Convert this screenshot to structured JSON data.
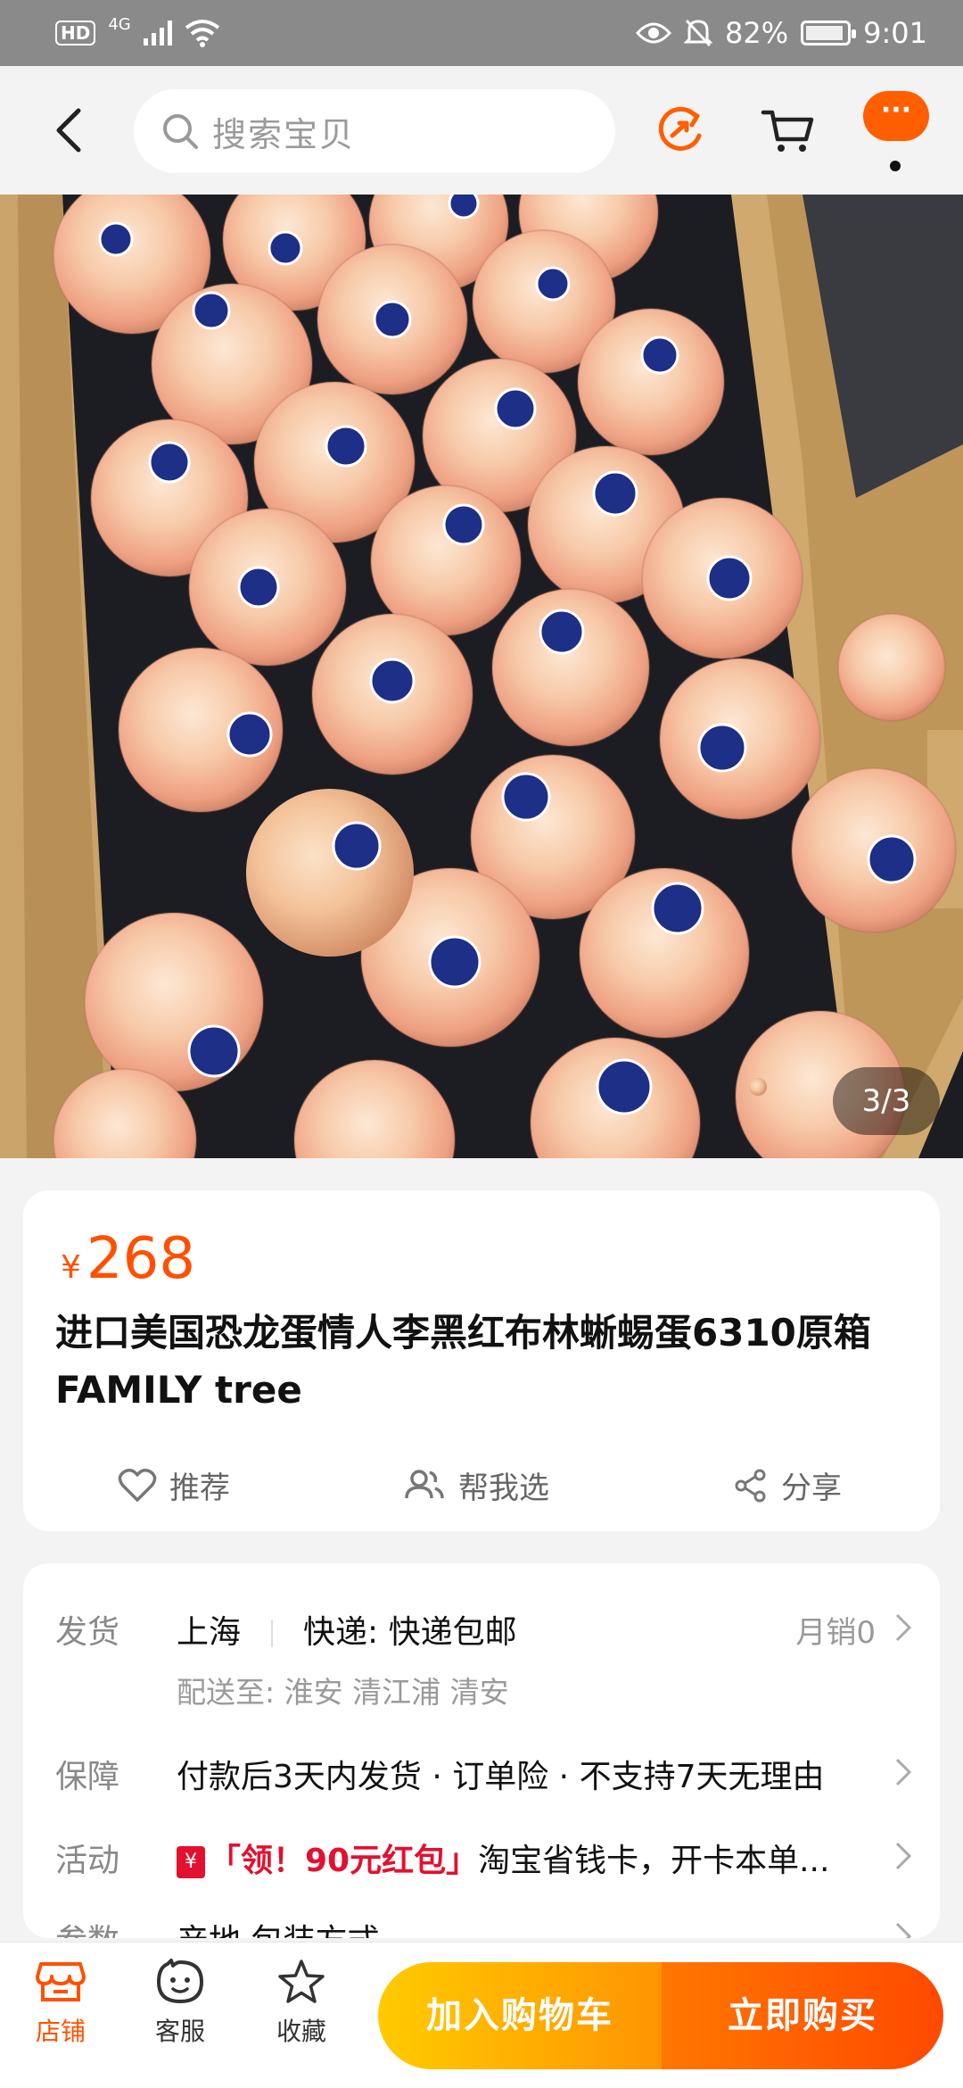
{
  "status_bar": {
    "hd": "HD",
    "network": "4G",
    "battery": "82%",
    "time": "9:01"
  },
  "top_nav": {
    "search_placeholder": "搜索宝贝",
    "more_label": "···",
    "accent_color": "#ff5f00"
  },
  "gallery": {
    "indicator": "3/3"
  },
  "product": {
    "currency": "¥",
    "price": "268",
    "title": "进口美国恐龙蛋情人李黑红布林蜥蜴蛋6310原箱 FAMILY tree",
    "actions": {
      "recommend": "推荐",
      "help_choose": "帮我选",
      "share": "分享"
    }
  },
  "info": {
    "shipping": {
      "label": "发货",
      "origin": "上海",
      "express": "快递: 快递包邮",
      "monthly_sales": "月销0",
      "deliver_to": "配送至: 淮安 清江浦 清安"
    },
    "guarantee": {
      "label": "保障",
      "text": "付款后3天内发货 · 订单险 · 不支持7天无理由"
    },
    "promotion": {
      "label": "活动",
      "tag_icon": "¥",
      "red_text": "「领！90元红包」",
      "text": "淘宝省钱卡，开卡本单..."
    },
    "params": {
      "label": "参数",
      "text": "产地 包装方式"
    }
  },
  "bottom_bar": {
    "store": "店铺",
    "service": "客服",
    "favorite": "收藏",
    "add_to_cart": "加入购物车",
    "buy_now": "立即购买"
  }
}
